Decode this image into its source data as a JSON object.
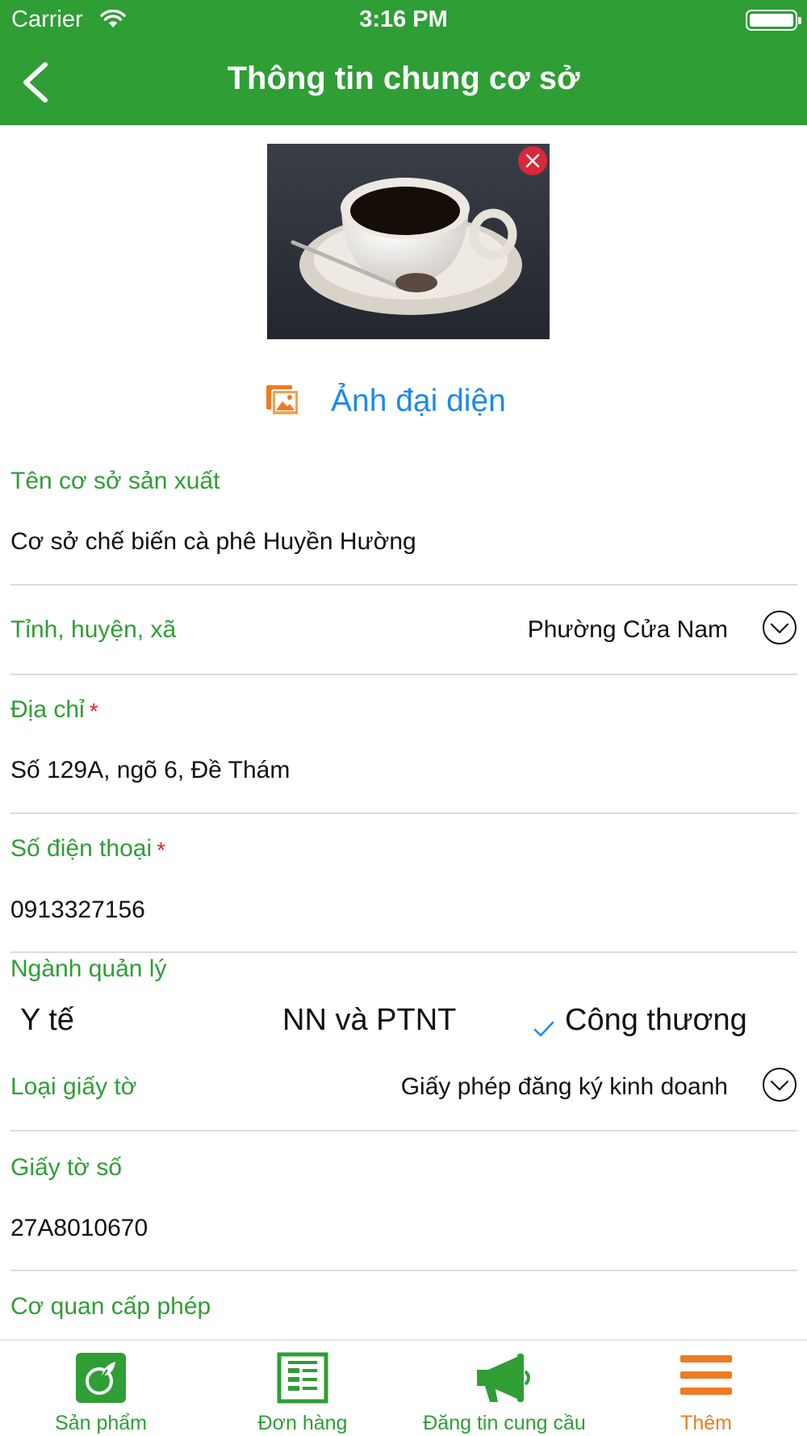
{
  "status_bar": {
    "carrier": "Carrier",
    "time": "3:16 PM"
  },
  "nav": {
    "title": "Thông tin chung cơ sở"
  },
  "avatar": {
    "label": "Ảnh đại diện"
  },
  "form": {
    "facility_name": {
      "label": "Tên cơ sở sản xuất",
      "value": "Cơ sở chế biến cà phê Huyền Hường"
    },
    "location": {
      "label": "Tỉnh, huyện, xã",
      "value": "Phường Cửa Nam"
    },
    "address": {
      "label": "Địa chỉ",
      "required_mark": "*",
      "value": "Số 129A, ngõ 6, Đề Thám"
    },
    "phone": {
      "label": "Số điện thoại",
      "required_mark": "*",
      "value": "0913327156"
    },
    "sector": {
      "label": "Ngành quản lý",
      "options": [
        "Y tế",
        "NN và PTNT",
        "Công thương"
      ],
      "selected": "Công thương"
    },
    "document_type": {
      "label": "Loại giấy tờ",
      "value": "Giấy phép đăng ký kinh doanh"
    },
    "document_number": {
      "label": "Giấy tờ số",
      "value": "27A8010670"
    },
    "issuer": {
      "label": "Cơ quan cấp phép"
    }
  },
  "tabbar": {
    "items": [
      {
        "label": "Sản phẩm",
        "icon": "product-icon",
        "active": false
      },
      {
        "label": "Đơn hàng",
        "icon": "order-icon",
        "active": false
      },
      {
        "label": "Đăng tin cung cầu",
        "icon": "megaphone-icon",
        "active": false
      },
      {
        "label": "Thêm",
        "icon": "menu-icon",
        "active": true
      }
    ]
  },
  "colors": {
    "primary_green": "#2E9E35",
    "accent_orange": "#F07A20",
    "link_blue": "#1E88F0",
    "required_red": "#E0242F"
  }
}
